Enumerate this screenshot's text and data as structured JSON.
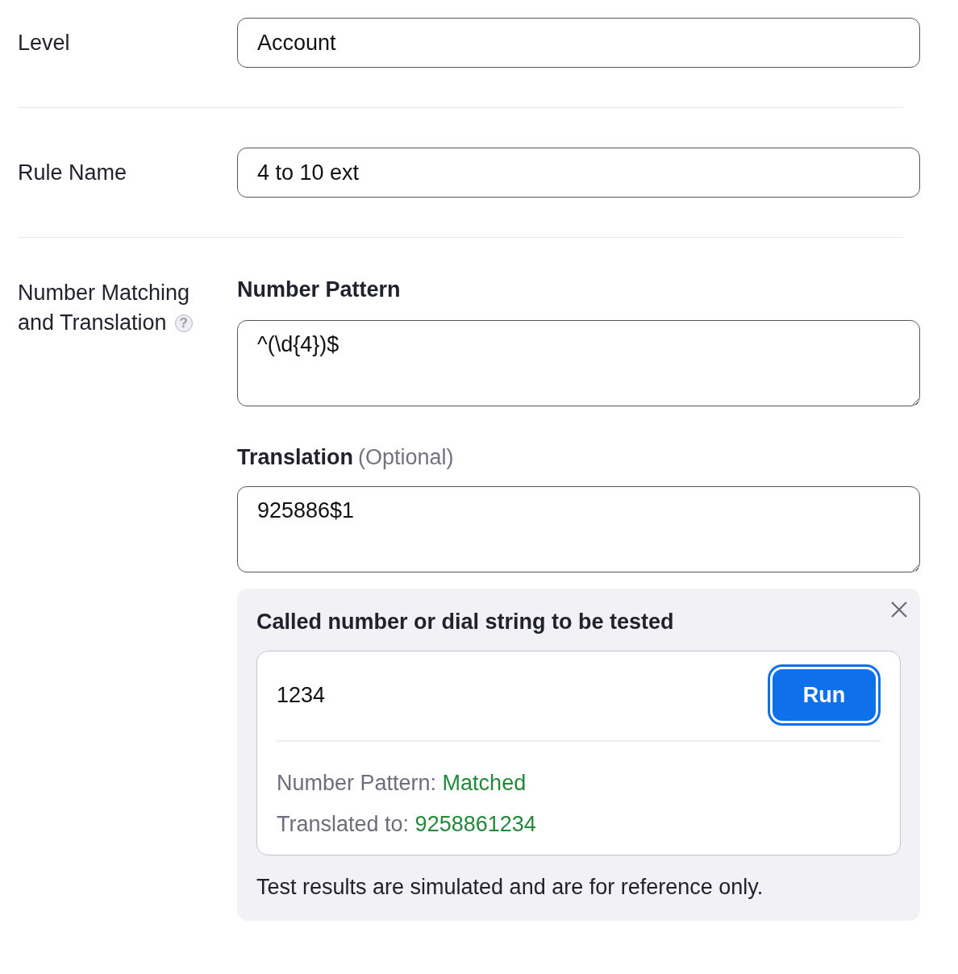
{
  "rows": [
    {
      "label": "Level",
      "value": "Account"
    },
    {
      "label": "Rule Name",
      "value": "4 to 10 ext"
    }
  ],
  "matching": {
    "label_lines": [
      "Number Matching",
      "and Translation"
    ],
    "help_icon": "?",
    "pattern": {
      "label": "Number Pattern",
      "value": "^(\\d{4})$"
    },
    "translation": {
      "label": "Translation",
      "hint": "(Optional)",
      "value": "925886$1"
    },
    "test": {
      "title": "Called number or dial string to be tested",
      "input": "1234",
      "button": "Run",
      "results": [
        {
          "label": "Number Pattern:",
          "value": "Matched"
        },
        {
          "label": "Translated to:",
          "value": "9258861234"
        }
      ],
      "note": "Test results are simulated and are for reference only."
    }
  }
}
